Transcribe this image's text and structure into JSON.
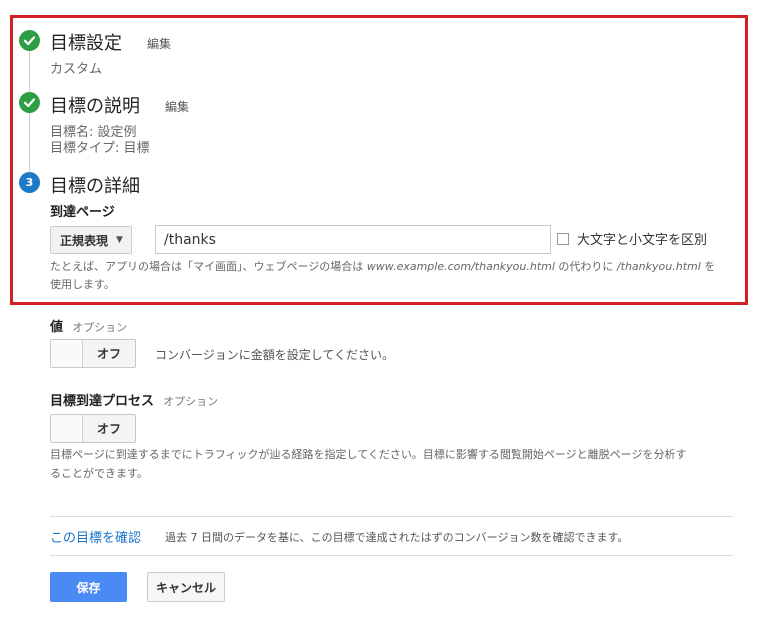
{
  "steps": [
    {
      "title": "目標設定",
      "edit": "編集",
      "details": [
        "カスタム"
      ]
    },
    {
      "title": "目標の説明",
      "edit": "編集",
      "details": [
        "目標名: 設定例",
        "目標タイプ: 目標"
      ]
    },
    {
      "number": "3",
      "title": "目標の詳細"
    }
  ],
  "destination": {
    "label": "到達ページ",
    "match_type": "正規表現",
    "value": "/thanks",
    "case_sensitive_label": "大文字と小文字を区別",
    "hint_line1_a": "たとえば、アプリの場合は「マイ画面」、ウェブページの場合は ",
    "hint_url": "www.example.com/thankyou.html",
    "hint_line1_b": " の代わりに ",
    "hint_path": "/thankyou.html",
    "hint_line1_c": " を",
    "hint_line2": "使用します。"
  },
  "value_section": {
    "label": "値",
    "optional": "オプション",
    "toggle": "オフ",
    "description": "コンバージョンに金額を設定してください。"
  },
  "funnel_section": {
    "label": "目標到達プロセス",
    "optional": "オプション",
    "toggle": "オフ",
    "description_line1": "目標ページに到達するまでにトラフィックが辿る経路を指定してください。目標に影響する閲覧開始ページと離脱ページを分析す",
    "description_line2": "ることができます。"
  },
  "verify": {
    "link": "この目標を確認",
    "text": "過去 7 日間のデータを基に、この目標で達成されたはずのコンバージョン数を確認できます。"
  },
  "buttons": {
    "save": "保存",
    "cancel": "キャンセル"
  },
  "colors": {
    "highlight_border": "#d21f26",
    "check": "#2e9e44",
    "step_number": "#1e7ac7",
    "link": "#1a73c9",
    "save_button": "#4a8af4"
  }
}
